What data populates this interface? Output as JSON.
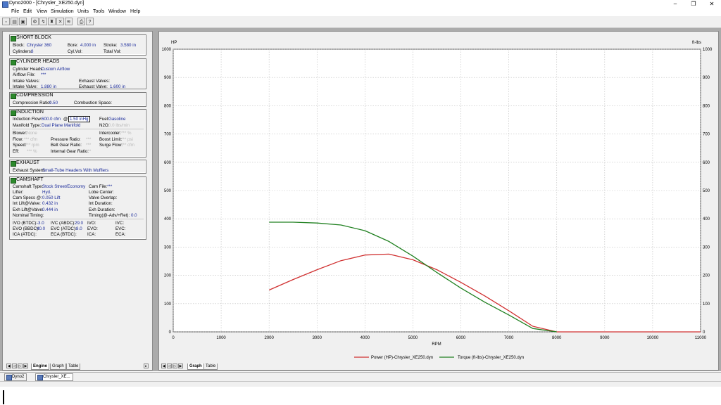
{
  "window": {
    "title": "Dyno2000 - [Chrysler_XE250.dyn]",
    "min_glyph": "–",
    "max_glyph": "❐",
    "close_glyph": "✕"
  },
  "menu": [
    "File",
    "Edit",
    "View",
    "Simulation",
    "Units",
    "Tools",
    "Window",
    "Help"
  ],
  "toolbar_icons": [
    "new-icon",
    "open-icon",
    "save-icon",
    "engine-icon",
    "run-icon",
    "piston-icon",
    "compare-icon",
    "graph-icon",
    "print-icon",
    "help-icon"
  ],
  "short_block": {
    "header": "SHORT BLOCK",
    "block_label": "Block:",
    "block_value": "Chrysler 360",
    "bore_label": "Bore:",
    "bore_value": "4.000 in",
    "stroke_label": "Stroke:",
    "stroke_value": "3.580 in",
    "cylinders_label": "Cylinders:",
    "cylinders_value": "8",
    "cylvol_label": "Cyl.Vol:",
    "totalvol_label": "Total Vol:"
  },
  "cylinder_heads": {
    "header": "CYLINDER HEADS",
    "heads_label": "Cylinder Heads:",
    "heads_value": "Custom Airflow",
    "airflow_label": "Airflow File:",
    "airflow_value": "***",
    "intake_valves_label": "Intake Valves:",
    "exhaust_valves_label": "Exhaust Valves:",
    "intake_valve_label": "Intake Valve:",
    "intake_valve_value": "1.880 in",
    "exhaust_valve_label": "Exhaust Valve:",
    "exhaust_valve_value": "1.600 in"
  },
  "compression": {
    "header": "COMPRESSION",
    "ratio_label": "Compression Ratio:",
    "ratio_value": "9.50",
    "space_label": "Combustion Space:"
  },
  "induction": {
    "header": "INDUCTION",
    "flow_label": "Induction Flow:",
    "flow_value": "600.0 cfm",
    "at": "@",
    "flow_input": "1.50 inHg",
    "fuel_label": "Fuel:",
    "fuel_value": "Gasoline",
    "manifold_label": "Manifold Type:",
    "manifold_value": "Dual Plane Manifold",
    "n2o_label": "N2O:",
    "n2o_value": "0.0 lbs/min",
    "blower_label": "Blower:",
    "blower_value": "None",
    "intercooler_label": "Intercooler:",
    "intercooler_value": "*** %",
    "bflow_label": "Flow:",
    "bflow_value": "*** cfm",
    "pressure_label": "Pressure Ratio:",
    "pressure_value": "***",
    "boost_label": "Boost Limit:",
    "boost_value": "*** psi",
    "speed_label": "Speed:",
    "speed_value": "*** rpm",
    "belt_label": "Belt Gear Ratio:",
    "belt_value": "***",
    "surge_label": "Surge Flow:",
    "surge_value": "*** cfm",
    "eff_label": "Eff:",
    "eff_value": "*** %",
    "internal_label": "Internal Gear Ratio:",
    "internal_value": "***"
  },
  "exhaust": {
    "header": "EXHAUST",
    "system_label": "Exhaust System:",
    "system_value": "Small-Tube Headers With Mufflers"
  },
  "camshaft": {
    "header": "CAMSHAFT",
    "type_label": "Camshaft Type:",
    "type_value": "Stock Street/Economy",
    "file_label": "Cam File:",
    "file_value": "***",
    "lifter_label": "Lifter:",
    "lifter_value": "Hyd.",
    "lobe_label": "Lobe Center:",
    "specs_label": "Cam Specs @:",
    "specs_value": "0.050 Lift",
    "overlap_label": "Valve Overlap:",
    "intlift_label": "Int Lift@Valve:",
    "intlift_value": "0.432 in",
    "intdur_label": "Int Duration:",
    "exhlift_label": "Exh Lift@Valve:",
    "exhlift_value": "0.444 in",
    "exhdur_label": "Exh Duration:",
    "nominal_label": "Nominal Timing:",
    "timing_label": "Timing(@-Adv/+Ret):",
    "timing_value": "0.0",
    "ivo_btdc_label": "IVO (BTDC):",
    "ivo_btdc_value": "-3.0",
    "ivc_abdc_label": "IVC (ABDC):",
    "ivc_abdc_value": "29.0",
    "ivo_label": "IVO:",
    "ivc_label": "IVC:",
    "evo_bbdc_label": "EVO (BBDC):",
    "evo_bbdc_value": "40.0",
    "evc_atdc_label": "EVC (ATDC):",
    "evc_atdc_value": "-8.0",
    "evo_label": "EVO:",
    "evc_label": "EVC:",
    "ica_atdc_label": "ICA (ATDC):",
    "eca_btdc_label": "ECA (BTDC):",
    "ica_label": "ICA:",
    "eca_label": "ECA:"
  },
  "left_tabs": [
    "Engine",
    "Graph",
    "Table"
  ],
  "graph_tabs": [
    "Graph",
    "Table"
  ],
  "taskbar": [
    "Dyno2",
    "Chrysler_XE..."
  ],
  "colors": {
    "power": "#d03030",
    "torque": "#208020",
    "grid": "#bdbdbd"
  },
  "chart_data": {
    "type": "line",
    "xlabel": "RPM",
    "ylabel_left": "HP",
    "ylabel_right": "ft-lbs",
    "xlim": [
      0,
      11000
    ],
    "ylim": [
      0,
      1000
    ],
    "x_ticks": [
      0,
      1000,
      2000,
      3000,
      4000,
      5000,
      6000,
      7000,
      8000,
      9000,
      10000,
      11000
    ],
    "y_ticks": [
      0,
      100,
      200,
      300,
      400,
      500,
      600,
      700,
      800,
      900,
      1000
    ],
    "grid": true,
    "legend_position": "bottom",
    "series": [
      {
        "name": "Power (HP)-Chrysler_XE250.dyn",
        "color": "#d03030",
        "x": [
          2000,
          2500,
          3000,
          3500,
          4000,
          4500,
          5000,
          5500,
          6000,
          6500,
          7000,
          7500,
          8000,
          11000
        ],
        "y": [
          148,
          185,
          220,
          252,
          272,
          275,
          255,
          220,
          175,
          127,
          75,
          20,
          0,
          0
        ]
      },
      {
        "name": "Torque (ft-lbs)-Chrysler_XE250.dyn",
        "color": "#208020",
        "x": [
          2000,
          2500,
          3000,
          3500,
          4000,
          4500,
          5000,
          5500,
          6000,
          6500,
          7000,
          7500,
          8000
        ],
        "y": [
          388,
          388,
          385,
          378,
          358,
          320,
          268,
          210,
          155,
          105,
          60,
          12,
          0
        ]
      }
    ]
  }
}
